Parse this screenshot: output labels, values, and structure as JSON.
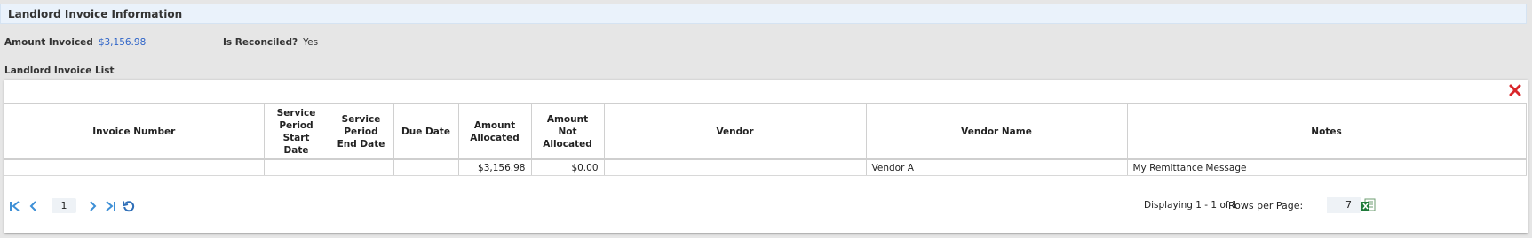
{
  "section": {
    "title": "Landlord Invoice Information"
  },
  "fields": {
    "amount_invoiced_label": "Amount Invoiced",
    "amount_invoiced_value": "$3,156.98",
    "is_reconciled_label": "Is Reconciled?",
    "is_reconciled_value": "Yes"
  },
  "list": {
    "title": "Landlord Invoice List"
  },
  "table": {
    "headers": {
      "invoice_number": "Invoice Number",
      "service_start": "Service Period Start Date",
      "service_end": "Service Period End Date",
      "due_date": "Due Date",
      "amount_allocated": "Amount Allocated",
      "amount_not_allocated": "Amount Not Allocated",
      "vendor": "Vendor",
      "vendor_name": "Vendor Name",
      "notes": "Notes"
    },
    "rows": [
      {
        "invoice_number": "",
        "service_start": "",
        "service_end": "",
        "due_date": "",
        "amount_allocated": "$3,156.98",
        "amount_not_allocated": "$0.00",
        "vendor": "",
        "vendor_name": "Vendor A",
        "notes": "My Remittance Message"
      }
    ]
  },
  "pager": {
    "current_page": "1",
    "display_text": "Displaying 1 - 1 of 1",
    "rows_per_page_label": "Rows per Page:",
    "rows_per_page_value": "7"
  },
  "colors": {
    "accent_blue": "#3d8fd6",
    "link_blue": "#2e64c8",
    "close_red": "#d9262b",
    "excel_green": "#1f7a3a"
  },
  "icons": [
    "close-icon",
    "first-page-icon",
    "prev-page-icon",
    "next-page-icon",
    "last-page-icon",
    "refresh-icon",
    "excel-export-icon"
  ]
}
